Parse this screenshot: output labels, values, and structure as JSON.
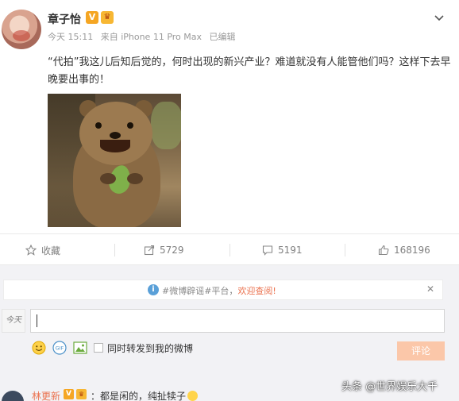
{
  "post": {
    "username": "章子怡",
    "badge_v": "V",
    "badge_crown": "♛",
    "time": "今天 15:11",
    "source": "来自 iPhone 11 Pro Max",
    "edited": "已编辑",
    "text": "“代拍”我这儿后知后觉的，何时出现的新兴产业？难道就没有人能管他们吗？这样下去早晚要出事的！"
  },
  "actions": {
    "favorite": {
      "label": "收藏",
      "icon": "star-icon"
    },
    "repost": {
      "count": "5729",
      "icon": "repost-icon"
    },
    "comment": {
      "count": "5191",
      "icon": "comment-icon"
    },
    "like": {
      "count": "168196",
      "icon": "thumbs-up-icon"
    }
  },
  "comment_box": {
    "notice_prefix": "#微博辟谣#平台，",
    "notice_highlight": "欢迎查阅!",
    "avatar_text": "今天",
    "input_value": "",
    "repost_checkbox_label": "同时转发到我的微博",
    "submit_label": "评论"
  },
  "next_comment": {
    "name": "林更新",
    "text": "：都是闲的，纯扯犊子"
  },
  "watermark": "头条 @世界娱乐大千",
  "colors": {
    "accent": "#eb7350",
    "submit_disabled": "#fbc7a9",
    "badge": "#f5a623"
  }
}
